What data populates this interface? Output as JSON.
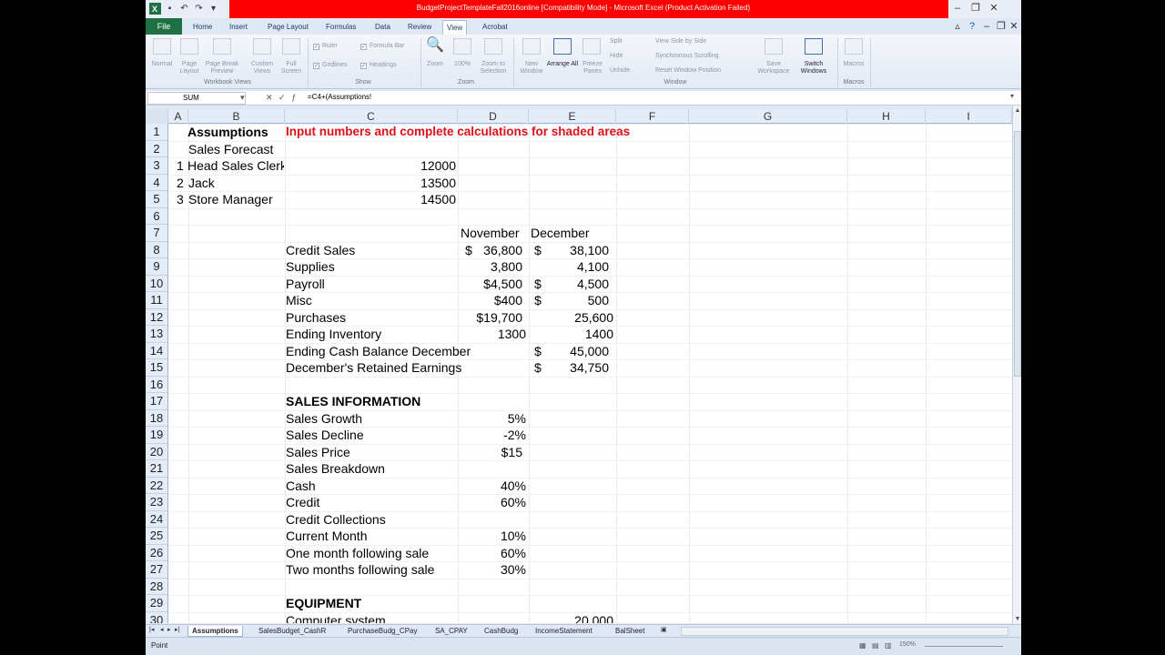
{
  "window": {
    "title": "BudgetProjectTemplateFall2016online  [Compatibility Mode]  -  Microsoft Excel (Product Activation Failed)"
  },
  "tabs": [
    "Home",
    "Insert",
    "Page Layout",
    "Formulas",
    "Data",
    "Review",
    "View",
    "Acrobat"
  ],
  "file_tab": "File",
  "active_tab": "View",
  "ribbon": {
    "workbook_views": {
      "group": "Workbook Views",
      "normal": "Normal",
      "page_layout": "Page Layout",
      "page_break": "Page Break Preview",
      "custom_views": "Custom Views",
      "full_screen": "Full Screen"
    },
    "show": {
      "group": "Show",
      "ruler": "Ruler",
      "formula_bar": "Formula Bar",
      "gridlines": "Gridlines",
      "headings": "Headings"
    },
    "zoom": {
      "group": "Zoom",
      "zoom": "Zoom",
      "hundred": "100%",
      "zoom_selection": "Zoom to Selection"
    },
    "window": {
      "group": "Window",
      "new_window": "New Window",
      "arrange_all": "Arrange All",
      "freeze": "Freeze Panes",
      "split": "Split",
      "hide": "Hide",
      "unhide": "Unhide",
      "side_by_side": "View Side by Side",
      "sync_scroll": "Synchronous Scrolling",
      "reset_pos": "Reset Window Position",
      "save_ws": "Save Workspace",
      "switch": "Switch Windows"
    },
    "macros": {
      "group": "Macros",
      "macros": "Macros"
    }
  },
  "formula_bar": {
    "name_box": "SUM",
    "formula": "=C4+(Assumptions!"
  },
  "columns": [
    "A",
    "B",
    "C",
    "D",
    "E",
    "F",
    "G",
    "H",
    "I"
  ],
  "rows": [
    "1",
    "2",
    "3",
    "4",
    "5",
    "6",
    "7",
    "8",
    "9",
    "10",
    "11",
    "12",
    "13",
    "14",
    "15",
    "16",
    "17",
    "18",
    "19",
    "20",
    "21",
    "22",
    "23",
    "24",
    "25",
    "26",
    "27",
    "28",
    "29",
    "30"
  ],
  "cells": {
    "b1": "Assumptions",
    "c1": "Input numbers and complete calculations for shaded areas",
    "b2": "Sales Forecast",
    "a3": "1",
    "b3": "Head Sales Clerk",
    "c3": "12000",
    "a4": "2",
    "b4": "Jack",
    "c4": "13500",
    "a5": "3",
    "b5": "Store Manager",
    "c5": "14500",
    "d7": "November",
    "e7": "December",
    "c8": "Credit Sales",
    "d8s": "$",
    "d8": "36,800",
    "e8s": "$",
    "e8": "38,100",
    "c9": "Supplies",
    "d9": "3,800",
    "e9": "4,100",
    "c10": "Payroll",
    "d10": "$4,500",
    "e10s": "$",
    "e10": "4,500",
    "c11": "Misc",
    "d11": "$400",
    "e11s": "$",
    "e11": "500",
    "c12": "Purchases",
    "d12": "$19,700",
    "e12": "25,600",
    "c13": "Ending Inventory",
    "d13": "1300",
    "e13": "1400",
    "c14": "Ending Cash Balance December",
    "e14s": "$",
    "e14": "45,000",
    "c15": "December's Retained Earnings",
    "e15s": "$",
    "e15": "34,750",
    "c17": "SALES INFORMATION",
    "c18": "Sales Growth",
    "d18": "5%",
    "c19": "Sales Decline",
    "d19": "-2%",
    "c20": "Sales Price",
    "d20": "$15",
    "c21": "Sales Breakdown",
    "c22": "Cash",
    "d22": "40%",
    "c23": "Credit",
    "d23": "60%",
    "c24": "Credit Collections",
    "c25": "Current Month",
    "d25": "10%",
    "c26": "One month following sale",
    "d26": "60%",
    "c27": "Two months following sale",
    "d27": "30%",
    "c29": "EQUIPMENT",
    "c30": "Computer system",
    "e30": "20,000"
  },
  "sheet_tabs": [
    "Assumptions",
    "SalesBudget_CashR",
    "PurchaseBudg_CPay",
    "SA_CPAY",
    "CashBudg",
    "IncomeStatement",
    "BalSheet"
  ],
  "status": {
    "mode": "Point",
    "zoom": "150%"
  }
}
